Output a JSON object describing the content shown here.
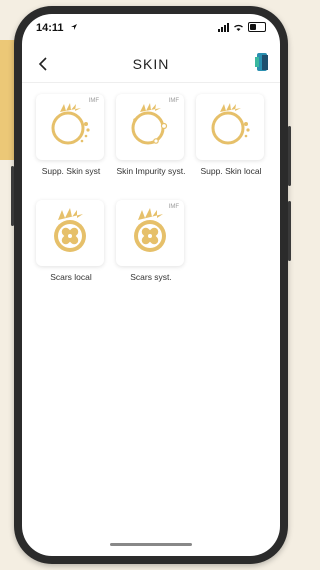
{
  "status_bar": {
    "time": "14:11"
  },
  "header": {
    "title": "SKIN",
    "back_icon": "chevron-left-icon",
    "action_icon": "device-icon"
  },
  "tiles": [
    {
      "label": "Supp. Skin syst",
      "badge": "IMF",
      "icon": "sun-ring-icon"
    },
    {
      "label": "Skin Impurity syst.",
      "badge": "IMF",
      "icon": "sun-ring-impurity-icon"
    },
    {
      "label": "Supp. Skin local",
      "badge": "",
      "icon": "sun-ring-icon"
    },
    {
      "label": "Scars local",
      "badge": "",
      "icon": "bandage-sun-icon"
    },
    {
      "label": "Scars syst.",
      "badge": "IMF",
      "icon": "bandage-sun-icon"
    }
  ],
  "colors": {
    "accent": "#e6c06a",
    "background": "#ffffff",
    "frame": "#2b2b2b"
  }
}
